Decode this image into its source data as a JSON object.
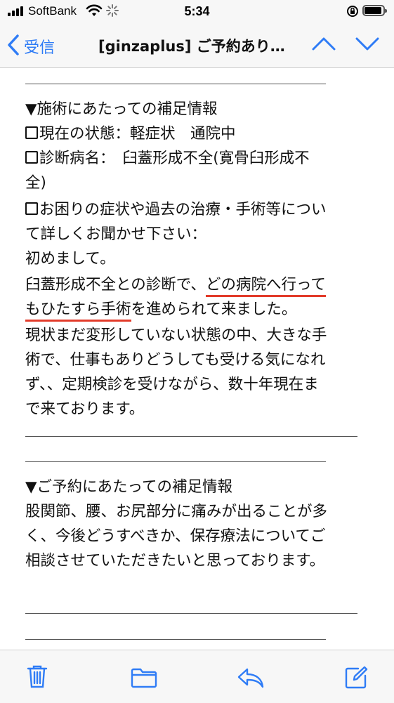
{
  "status": {
    "carrier": "SoftBank",
    "time": "5:34"
  },
  "nav": {
    "back_label": "受信",
    "title": "[ginzaplus] ご予約あり…"
  },
  "body": {
    "section1_heading": "▼施術にあたっての補足情報",
    "status_label": "現在の状態：軽症状　通院中",
    "diagnosis_label_line1": "診断病名：　臼蓋形成不全(寛骨臼形成不",
    "diagnosis_label_line2": "全)",
    "symptoms_label_line1": "お困りの症状や過去の治療・手術等につい",
    "symptoms_label_line2": "て詳しくお聞かせ下さい：",
    "p1": "初めまして。",
    "p2_line1_a": "臼蓋形成不全との診断で、",
    "p2_line1_b": "どの病院へ行って",
    "p2_line2_a": "もひたすら手術",
    "p2_line2_b": "を進められて来ました。",
    "p3_line1": "現状まだ変形していない状態の中、大きな手",
    "p3_line2": "術で、仕事もありどうしても受ける気になれ",
    "p3_line3": "ず、、定期検診を受けながら、数十年現在ま",
    "p3_line4": "で来ております。",
    "section2_heading": "▼ご予約にあたっての補足情報",
    "s2_line1": "股関節、腰、お尻部分に痛みが出ることが多",
    "s2_line2": "く、今後どうすべきか、保存療法についてご",
    "s2_line3": "相談させていただきたいと思っております。"
  },
  "colors": {
    "accent": "#2f7cf6",
    "highlight": "#e23b2a"
  },
  "toolbar": {
    "icons": [
      "trash-icon",
      "folder-icon",
      "reply-icon",
      "compose-icon"
    ]
  }
}
